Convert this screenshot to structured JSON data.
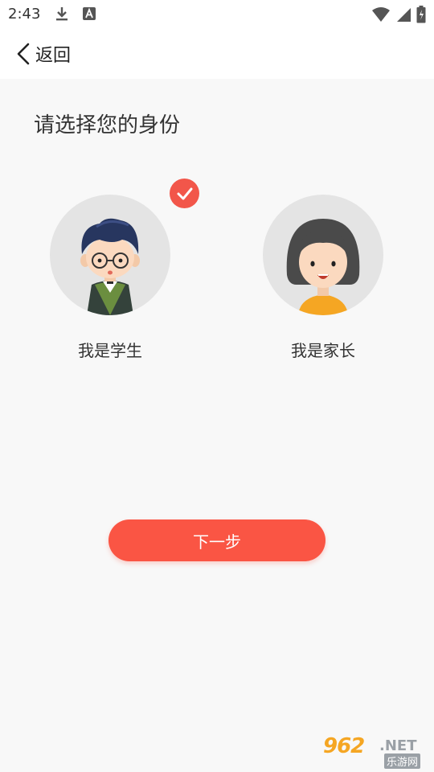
{
  "status_bar": {
    "time": "2:43"
  },
  "header": {
    "back_label": "返回"
  },
  "main": {
    "title": "请选择您的身份",
    "roles": [
      {
        "label": "我是学生",
        "selected": true
      },
      {
        "label": "我是家长",
        "selected": false
      }
    ],
    "next_button": "下一步"
  },
  "watermark": {
    "number": "962",
    "domain": ".NET",
    "sub": "乐游网"
  },
  "colors": {
    "accent": "#fa5544",
    "check": "#f2564a",
    "avatar_bg": "#e4e4e4"
  }
}
